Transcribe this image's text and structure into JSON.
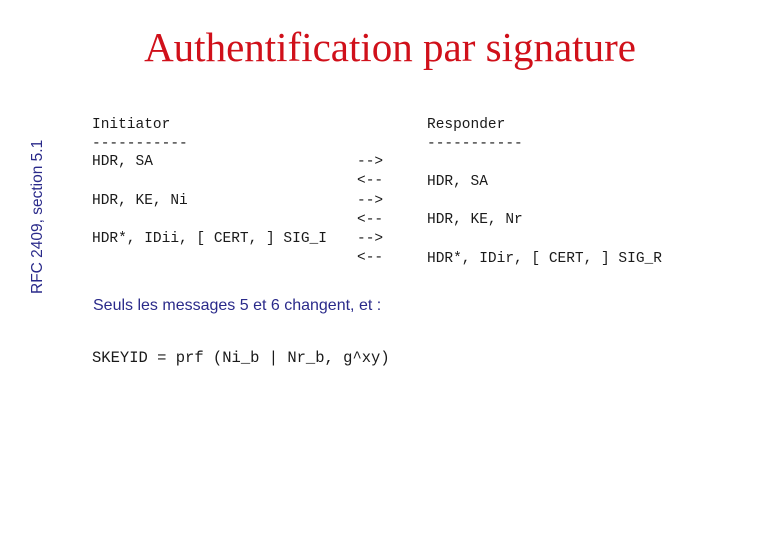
{
  "slide": {
    "title": "Authentification par signature",
    "side_label": "RFC 2409, section 5.1",
    "initiator": {
      "header": "Initiator",
      "underline": "-----------",
      "messages": [
        "HDR, SA",
        "HDR, KE, Ni",
        "HDR*, IDii, [ CERT, ] SIG_I"
      ]
    },
    "arrows": [
      "-->",
      "<--",
      "-->",
      "<--",
      "-->",
      "<--"
    ],
    "responder": {
      "header": "Responder",
      "underline": "-----------",
      "messages": [
        "HDR, SA",
        "HDR, KE, Nr",
        "HDR*, IDir, [ CERT, ] SIG_R"
      ]
    },
    "note": "Seuls les messages 5 et 6 changent, et :",
    "formula": "SKEYID = prf (Ni_b | Nr_b, g^xy)"
  }
}
